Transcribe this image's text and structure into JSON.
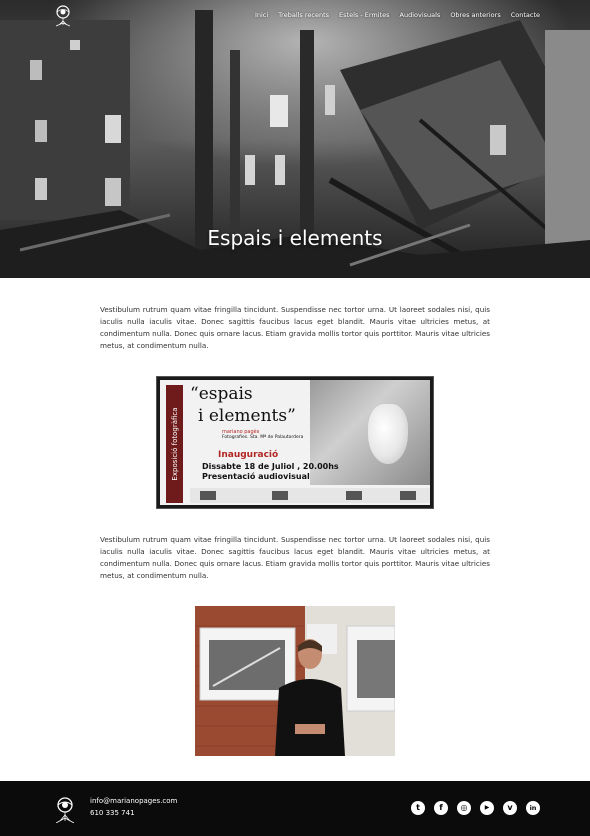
{
  "nav": {
    "items": [
      {
        "label": "Inici"
      },
      {
        "label": "Treballs recents"
      },
      {
        "label": "Estels - Ermites"
      },
      {
        "label": "Audiovisuals"
      },
      {
        "label": "Obres anteriors"
      },
      {
        "label": "Contacte"
      }
    ]
  },
  "hero": {
    "title": "Espais i elements"
  },
  "content": {
    "paragraph_1": "Vestibulum rutrum quam vitae fringilla tincidunt. Suspendisse nec tortor urna. Ut laoreet sodales nisi, quis iaculis nulla iaculis vitae. Donec sagittis faucibus lacus eget blandit. Mauris vitae ultricies metus, at condimentum nulla. Donec quis ornare lacus. Etiam gravida mollis tortor quis porttitor. Mauris vitae ultricies metus, at condimentum nulla.",
    "paragraph_2": "Vestibulum rutrum quam vitae fringilla tincidunt. Suspendisse nec tortor urna. Ut laoreet sodales nisi, quis iaculis nulla iaculis vitae. Donec sagittis faucibus lacus eget blandit. Mauris vitae ultricies metus, at condimentum nulla. Donec quis ornare lacus. Etiam gravida mollis tortor quis porttitor. Mauris vitae ultricies metus, at condimentum nulla."
  },
  "poster": {
    "side_text": "Exposició fotogràfica",
    "title_line1": "“espais",
    "title_line2": "i elements”",
    "author": "mariano pagès",
    "subtitle": "Fotografies. Sta. Mª de Palautordera",
    "inauguration": "Inauguració",
    "date": "Dissabte 18 de Juliol , 20.00hs",
    "presentation": "Presentació audiovisual"
  },
  "footer": {
    "email": "info@marianopages.com",
    "phone": "610 335 741",
    "social": [
      {
        "icon": "twitter-icon",
        "glyph": "t"
      },
      {
        "icon": "facebook-icon",
        "glyph": "f"
      },
      {
        "icon": "instagram-icon",
        "glyph": "◎"
      },
      {
        "icon": "youtube-icon",
        "glyph": "▶"
      },
      {
        "icon": "vimeo-icon",
        "glyph": "v"
      },
      {
        "icon": "linkedin-icon",
        "glyph": "in"
      }
    ]
  }
}
